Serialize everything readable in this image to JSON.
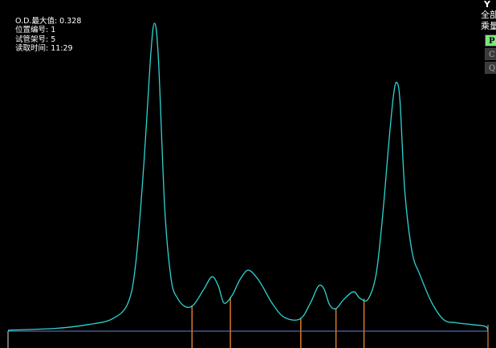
{
  "info": {
    "od_max": "O.D.最大值: 0.328",
    "position": "位置编号: 1",
    "rack": "试管架号: 5",
    "read_time": "读取时间: 11:29"
  },
  "right_panel": {
    "header": "Y",
    "all": "全部",
    "measure": "乘量",
    "buttons": [
      "P",
      "C",
      "Q"
    ]
  },
  "colors": {
    "curve": "#2fd4d0",
    "baseline": "#6a7fd6",
    "marker": "#e8802a",
    "highlight": "#7ce77c"
  },
  "chart_data": {
    "type": "line",
    "title": "",
    "xlabel": "",
    "ylabel": "",
    "xlim": [
      0,
      600
    ],
    "ylim": [
      0,
      0.34
    ],
    "series": [
      {
        "x": [
          0,
          60,
          100,
          130,
          150,
          160,
          170,
          178,
          183,
          188,
          196,
          204,
          212,
          222,
          232,
          245,
          255,
          263,
          270,
          280,
          290,
          300,
          310,
          318,
          330,
          345,
          365,
          378,
          388,
          395,
          402,
          410,
          420,
          432,
          440,
          450,
          460,
          468,
          476,
          482,
          486,
          490,
          496,
          505,
          515,
          530,
          545,
          560,
          580,
          597,
          600
        ],
        "y": [
          0.001,
          0.003,
          0.007,
          0.013,
          0.03,
          0.075,
          0.18,
          0.29,
          0.328,
          0.29,
          0.13,
          0.055,
          0.035,
          0.026,
          0.028,
          0.045,
          0.058,
          0.048,
          0.03,
          0.038,
          0.055,
          0.065,
          0.058,
          0.048,
          0.03,
          0.015,
          0.013,
          0.03,
          0.048,
          0.045,
          0.028,
          0.024,
          0.034,
          0.042,
          0.035,
          0.034,
          0.06,
          0.12,
          0.2,
          0.252,
          0.265,
          0.245,
          0.15,
          0.085,
          0.06,
          0.03,
          0.012,
          0.009,
          0.007,
          0.005,
          0.0
        ]
      }
    ],
    "grid": false,
    "fraction_markers_x": [
      230,
      278,
      366,
      410,
      445
    ]
  }
}
